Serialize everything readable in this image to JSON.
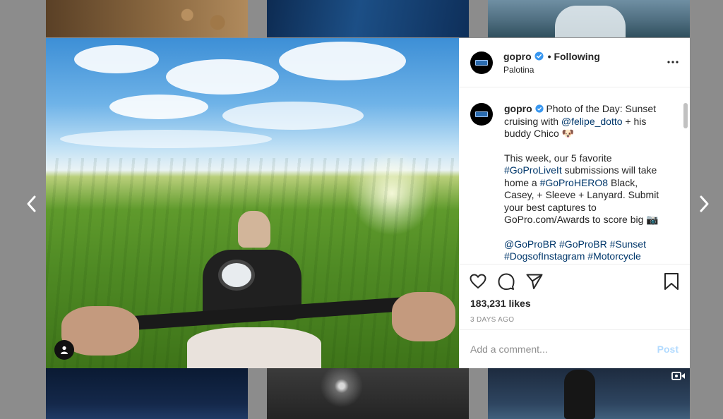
{
  "post": {
    "username": "gopro",
    "follow_status": "• Following",
    "location": "Palotina",
    "caption": {
      "username": "gopro",
      "line1_text": "Photo of the Day: Sunset cruising with ",
      "mention1": "@felipe_dotto",
      "line1_tail": " + his buddy Chico 🐶",
      "para2_pre": "This week, our 5 favorite ",
      "hashtag1": "#GoProLiveIt",
      "para2_mid": " submissions will take home a ",
      "hashtag2": "#GoProHERO8",
      "para2_tail": " Black, Casey, + Sleeve + Lanyard. Submit your best captures to GoPro.com/Awards to score big 📷",
      "tags": [
        "@GoProBR",
        "#GoProBR",
        "#Sunset",
        "#DogsofInstagram",
        "#Motorcycle"
      ]
    },
    "likes": "183,231 likes",
    "date": "3 DAYS AGO",
    "comment_placeholder": "Add a comment...",
    "post_label": "Post"
  },
  "colors": {
    "link": "#00376b",
    "post_disabled": "#b3dbff",
    "verified": "#3897f0"
  },
  "icons": [
    "chevron-left-icon",
    "chevron-right-icon",
    "verified-badge-icon",
    "more-options-icon",
    "heart-icon",
    "comment-icon",
    "share-icon",
    "bookmark-icon",
    "user-tag-icon",
    "video-icon"
  ]
}
